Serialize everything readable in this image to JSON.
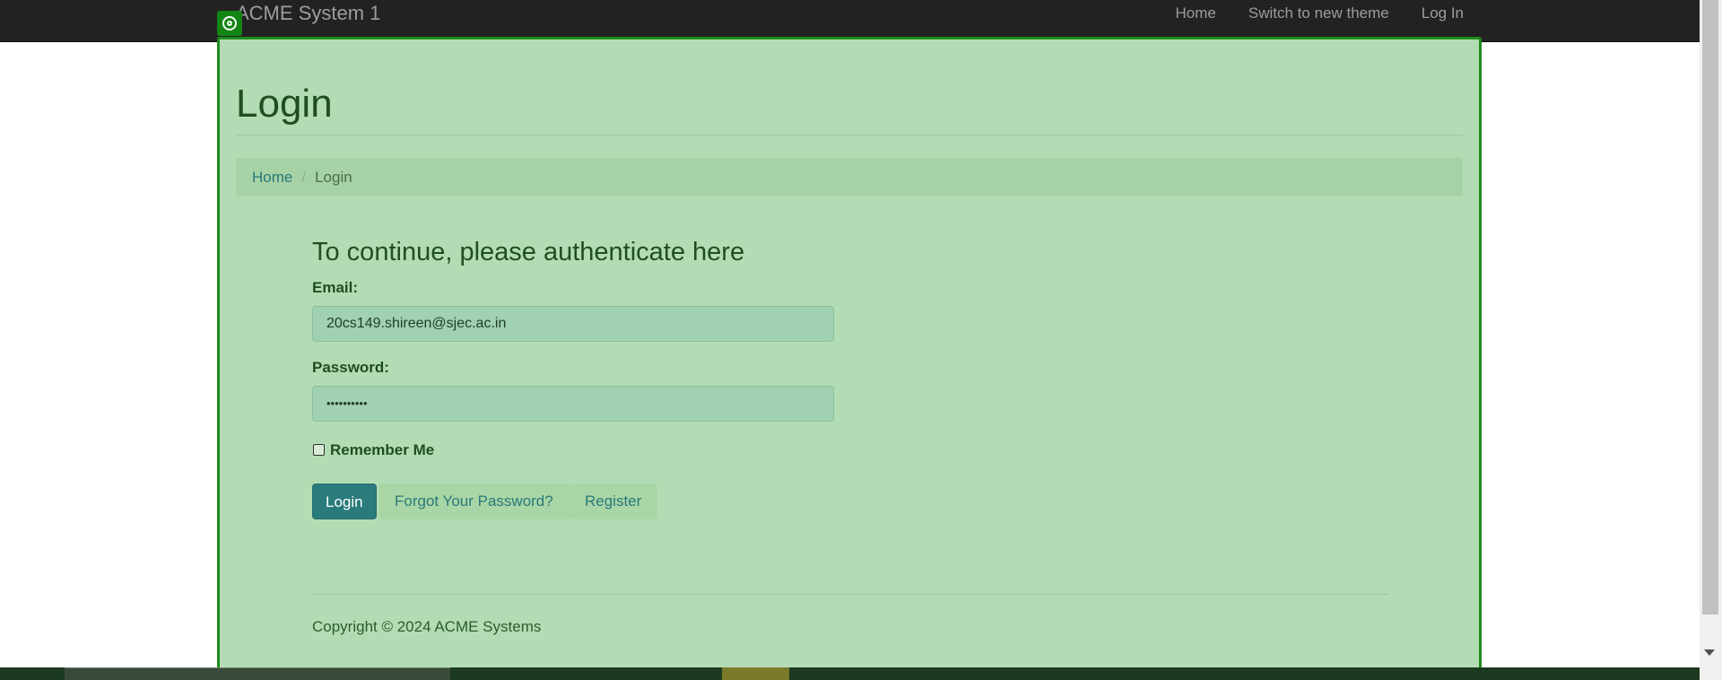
{
  "navbar": {
    "brand": "ACME System 1",
    "links": [
      {
        "label": "Home"
      },
      {
        "label": "Switch to new theme"
      },
      {
        "label": "Log In"
      }
    ]
  },
  "page": {
    "title": "Login"
  },
  "breadcrumb": {
    "home": "Home",
    "separator": "/",
    "current": "Login"
  },
  "form": {
    "heading": "To continue, please authenticate here",
    "email_label": "Email:",
    "email_value": "20cs149.shireen@sjec.ac.in",
    "password_label": "Password:",
    "password_value": "••••••••••",
    "remember_label": "Remember Me",
    "remember_checked": false,
    "login_button": "Login",
    "forgot_button": "Forgot Your Password?",
    "register_button": "Register"
  },
  "footer": {
    "copyright": "Copyright © 2024 ACME Systems"
  },
  "colors": {
    "navbar_bg": "#222222",
    "overlay_bg": "#b3dcb4",
    "overlay_border": "#1e8c1e",
    "primary_button": "#2a7b7c",
    "link": "#2a7a7a"
  },
  "icons": {
    "overlay_badge": "target-icon"
  }
}
